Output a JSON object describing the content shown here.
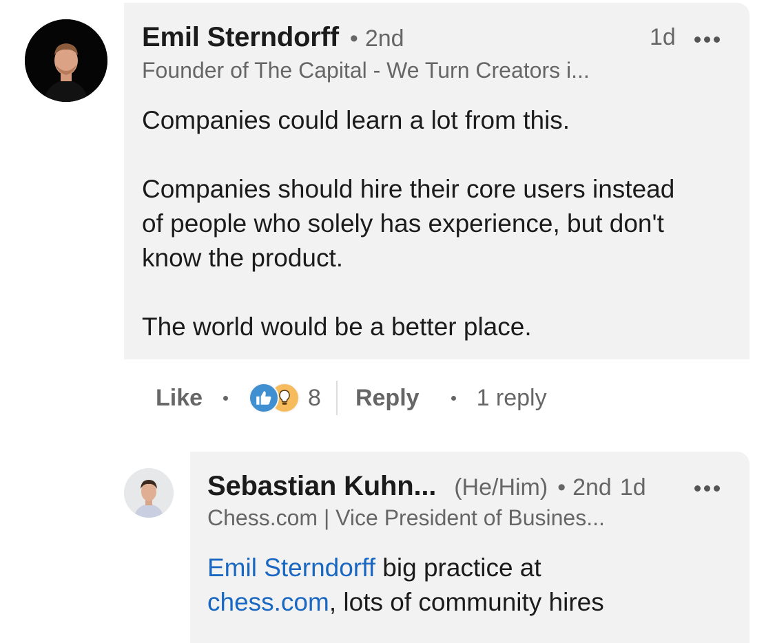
{
  "comment": {
    "author_name": "Emil Sterndorff",
    "degree": "2nd",
    "time": "1d",
    "headline": "Founder of The Capital - We Turn Creators i...",
    "paragraphs": [
      "Companies could learn a lot from this.",
      "Companies should hire their core users instead of people who solely has experience, but don't know the product.",
      "The world would be a better place."
    ],
    "avatar_icon": "profile-photo",
    "more_icon": "ellipsis-icon"
  },
  "actions": {
    "like_label": "Like",
    "reaction_icons": [
      "like-reaction-icon",
      "insightful-reaction-icon"
    ],
    "reaction_count": "8",
    "reply_label": "Reply",
    "replies_count": "1 reply"
  },
  "reply": {
    "author_name": "Sebastian Kuhn...",
    "pronouns": "(He/Him)",
    "degree": "2nd",
    "time": "1d",
    "headline": "Chess.com | Vice President of Busines...",
    "mention": "Emil Sterndorff",
    "text_after_mention": " big practice at",
    "link": "chess.com",
    "text_after_link": ", lots of community hires"
  },
  "colors": {
    "bubble_bg": "#f2f2f2",
    "link": "#1a67c2",
    "muted": "#666666",
    "like_blue": "#3f8fd1",
    "insight_yellow": "#f5bb5c"
  }
}
